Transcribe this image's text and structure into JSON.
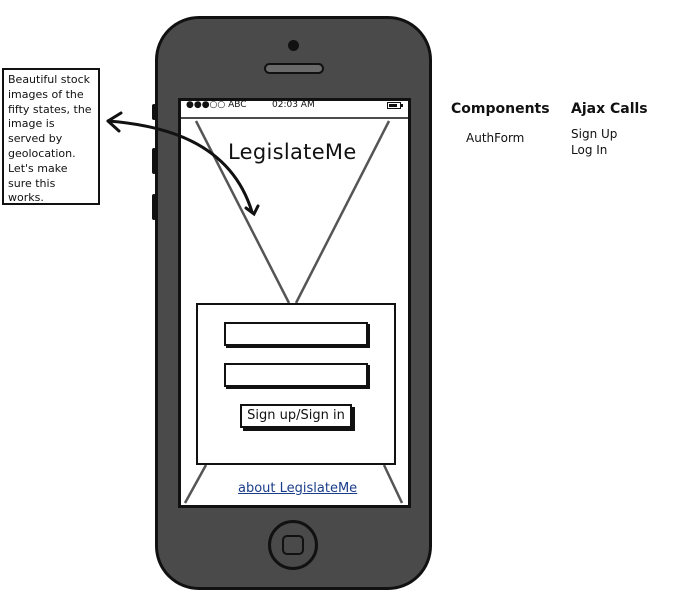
{
  "annotation": {
    "text": "Beautiful stock images of the fifty states, the image is served by geolocation. Let's make sure this works."
  },
  "status_bar": {
    "carrier": "●●●○○ ABC",
    "time": "02:03 AM"
  },
  "app": {
    "title": "LegislateMe",
    "submit_label": "Sign up/Sign in",
    "about_link": "about LegislateMe"
  },
  "components": {
    "heading": "Components",
    "items": [
      "AuthForm"
    ]
  },
  "ajax_calls": {
    "heading": "Ajax Calls",
    "items": [
      "Sign Up",
      "Log In"
    ]
  }
}
